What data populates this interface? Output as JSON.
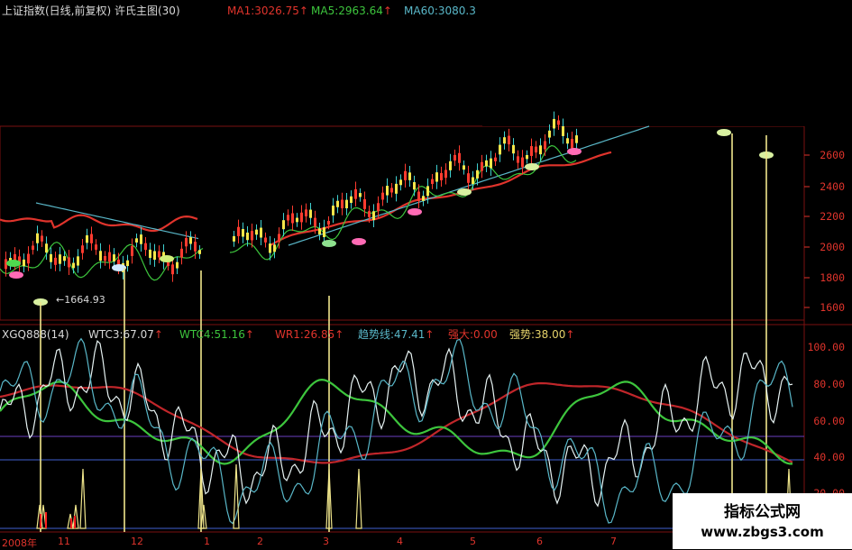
{
  "main_panel": {
    "title": "上证指数(日线,前复权) 许氏主图(30)",
    "ma1": "MA1:3026.75",
    "ma5": "MA5:2963.64",
    "ma60": "MA60:3080.3",
    "arrow": "↑",
    "price_axis": [
      "2600",
      "2400",
      "2200",
      "2000",
      "1800",
      "1600"
    ],
    "low_marker": "1664.93",
    "colors": {
      "ma1": "#e0342c",
      "ma5": "#3dc53d",
      "ma60": "#59b7c8",
      "axis": "#e0342c"
    }
  },
  "indicator_panel": {
    "name": "XGQ888(14)",
    "wtc3": "WTC3:67.07",
    "wtc4": "WTC4:51.16",
    "wr1": "WR1:26.85",
    "trend": "趋势线:47.41",
    "strong_big": "强大:0.00",
    "strong": "强势:38.00",
    "arrow": "↑",
    "scale": [
      "100.00",
      "80.00",
      "60.00",
      "40.00",
      "20.00"
    ]
  },
  "date_axis": [
    "2008年",
    "11",
    "12",
    "1",
    "2",
    "3",
    "4",
    "5",
    "6",
    "7"
  ],
  "watermark": {
    "title": "指标公式网",
    "url": "www.zbgs3.com"
  }
}
